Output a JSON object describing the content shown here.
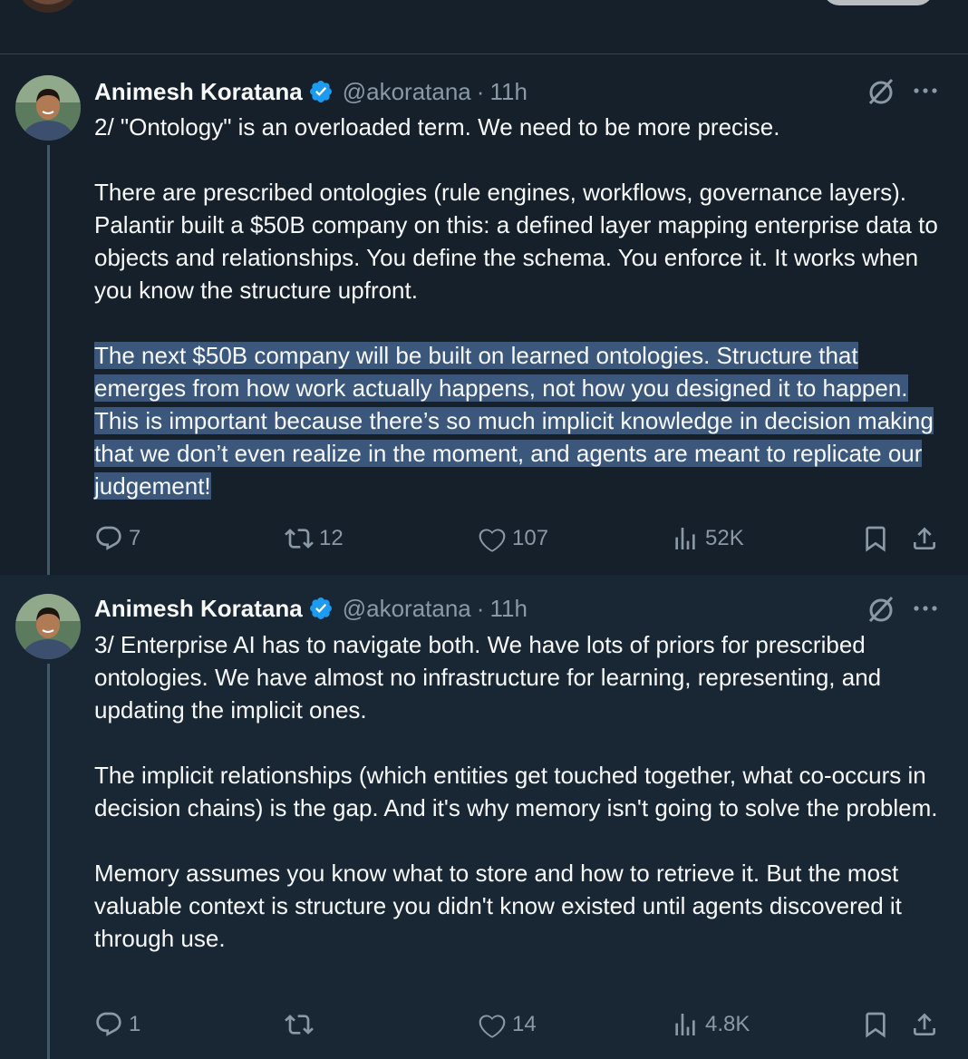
{
  "tweets": [
    {
      "author": {
        "name": "Animesh Koratana",
        "handle": "@akoratana",
        "time": "11h",
        "verified": true
      },
      "paragraphs": [
        "2/ \"Ontology\" is an overloaded term. We need to be more precise.",
        "There are prescribed ontologies (rule engines, workflows, governance layers). Palantir built a $50B company on this: a defined layer mapping enterprise data to objects and relationships. You define the schema. You enforce it. It works when you know the structure upfront.",
        "The next $50B company will be built on learned ontologies. Structure that emerges from how work actually happens, not how you designed it to happen. This is important because there’s so much implicit knowledge in decision making that we don’t even realize in the moment, and agents are meant to replicate our judgement!"
      ],
      "highlighted_paragraph_index": 2,
      "stats": {
        "replies": "7",
        "retweets": "12",
        "likes": "107",
        "views": "52K"
      }
    },
    {
      "author": {
        "name": "Animesh Koratana",
        "handle": "@akoratana",
        "time": "11h",
        "verified": true
      },
      "paragraphs": [
        "3/ Enterprise AI has to navigate both. We have lots of priors for prescribed ontologies. We have almost no infrastructure for learning, representing, and updating the implicit ones.",
        "The implicit relationships (which entities get touched together, what co-occurs in decision chains) is the gap. And it's why memory isn't going to solve the problem.",
        "Memory assumes you know what to store and how to retrieve it. But the most valuable context is structure you didn't know existed until agents discovered it through use."
      ],
      "stats": {
        "replies": "1",
        "retweets": "",
        "likes": "14",
        "views": "4.8K"
      }
    }
  ],
  "separator_dot": "·",
  "icons": [
    "reply-icon",
    "retweet-icon",
    "like-icon",
    "views-icon",
    "bookmark-icon",
    "share-icon",
    "grok-icon",
    "more-icon",
    "verified-badge-icon"
  ],
  "colors": {
    "background": "#15202b",
    "text": "#f7f9f9",
    "muted": "#8b98a5",
    "verified": "#1d9bf0",
    "highlight": "#3b587c"
  }
}
